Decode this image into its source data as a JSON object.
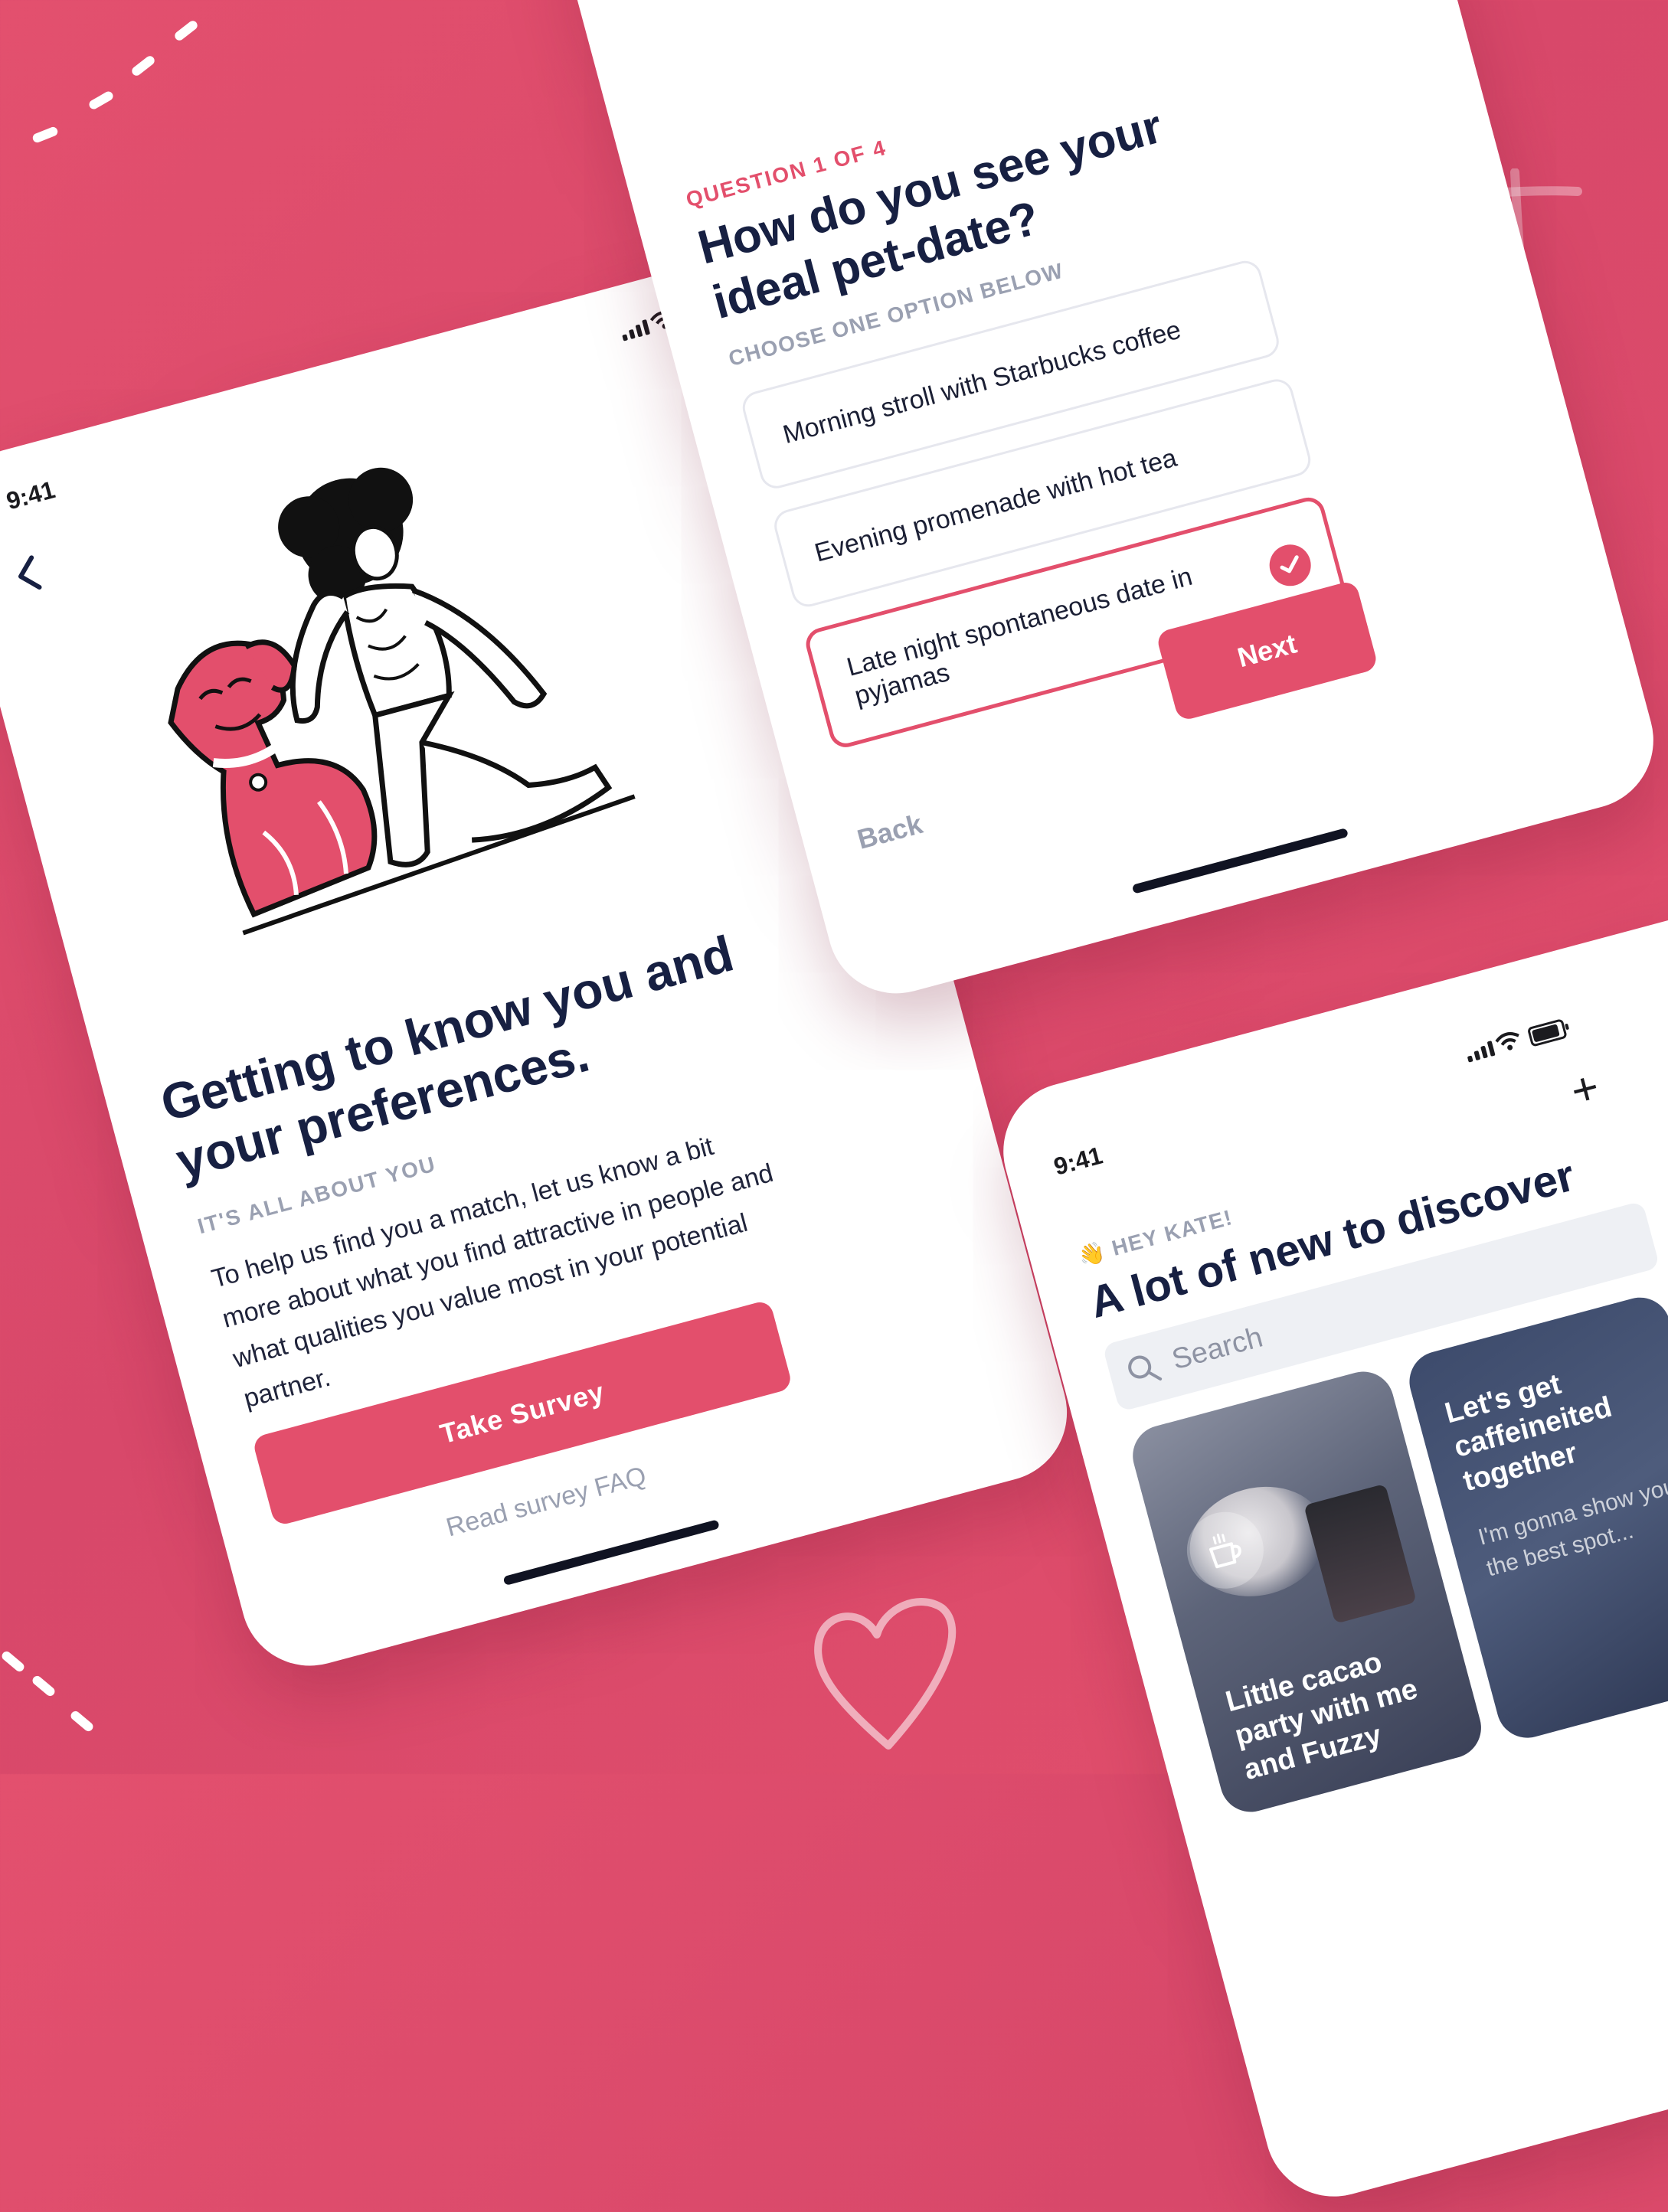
{
  "colors": {
    "brand": "#e34f6c",
    "navy": "#172042",
    "muted": "#9aa0b1",
    "background": "#dd4b6b"
  },
  "onboarding": {
    "status_time": "9:41",
    "title": "Getting to know you and your preferences.",
    "kicker": "IT'S ALL ABOUT YOU",
    "body": "To help us find you a match, let us know a bit more about what you find attractive in people and what qualities you value most in your potential partner.",
    "primary_button": "Take Survey",
    "secondary_link": "Read survey FAQ",
    "back_icon": "chevron-left-icon"
  },
  "survey": {
    "question_number": "QUESTION 1 OF 4",
    "question": "How do you see your ideal pet-date?",
    "instruction": "CHOOSE ONE OPTION BELOW",
    "options": [
      {
        "label": "Morning stroll with Starbucks coffee",
        "selected": false
      },
      {
        "label": "Evening promenade with hot tea",
        "selected": false
      },
      {
        "label": "Late night spontaneous date in pyjamas",
        "selected": true
      }
    ],
    "next_button": "Next",
    "back_button": "Back"
  },
  "discover": {
    "status_time": "9:41",
    "greeting": "👋 HEY KATE!",
    "title": "A lot of new to discover",
    "search_placeholder": "Search",
    "cards": [
      {
        "title": "Little cacao party with me and Fuzzy",
        "icon": "coffee-cup-icon"
      },
      {
        "title": "Let's get caffeineited together",
        "subtitle": "I'm gonna show you the best spot..."
      }
    ]
  }
}
